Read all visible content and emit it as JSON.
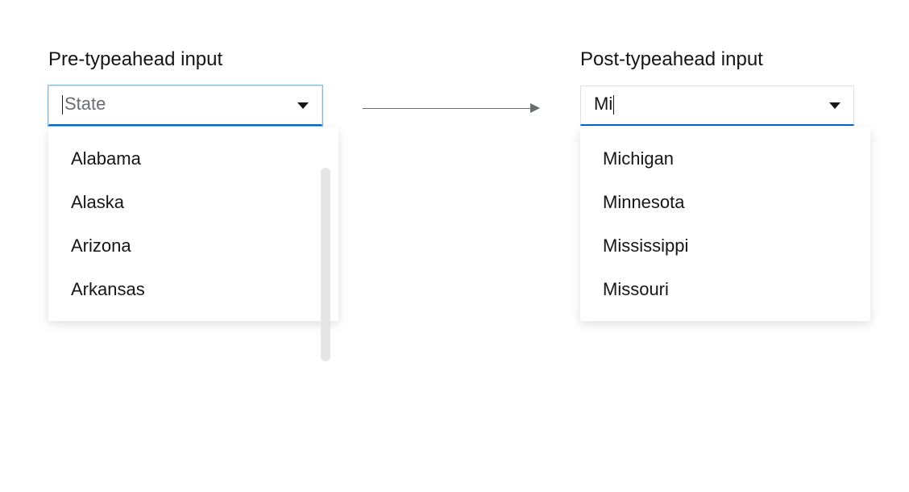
{
  "left": {
    "label": "Pre-typeahead input",
    "placeholder": "State",
    "value": "",
    "options": [
      "Alabama",
      "Alaska",
      "Arizona",
      "Arkansas"
    ]
  },
  "right": {
    "label": "Post-typeahead input",
    "value": "Mi",
    "options": [
      "Michigan",
      "Minnesota",
      "Mississippi",
      "Missouri"
    ]
  }
}
